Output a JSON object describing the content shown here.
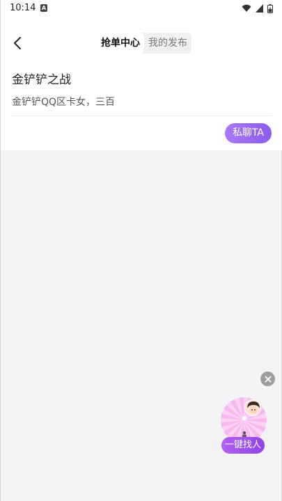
{
  "status_bar": {
    "time": "10:14",
    "notification_letter": "A",
    "icons": [
      "wifi-icon",
      "signal-icon",
      "battery-icon"
    ]
  },
  "header": {
    "back_icon": "chevron-left-icon",
    "tabs": [
      {
        "label": "抢单中心",
        "active": true
      },
      {
        "label": "我的发布",
        "active": false
      }
    ]
  },
  "order_card": {
    "title": "金铲铲之战",
    "description": "金铲铲QQ区卡女，三百",
    "chat_button_label": "私聊TA"
  },
  "float_widget": {
    "close_icon": "close-icon",
    "label": "一键找人"
  },
  "colors": {
    "accent": "#9b6bf3",
    "background": "#f4f3f6",
    "orb_pink": "#f7b8ee",
    "label_purple": "#a052ec"
  }
}
